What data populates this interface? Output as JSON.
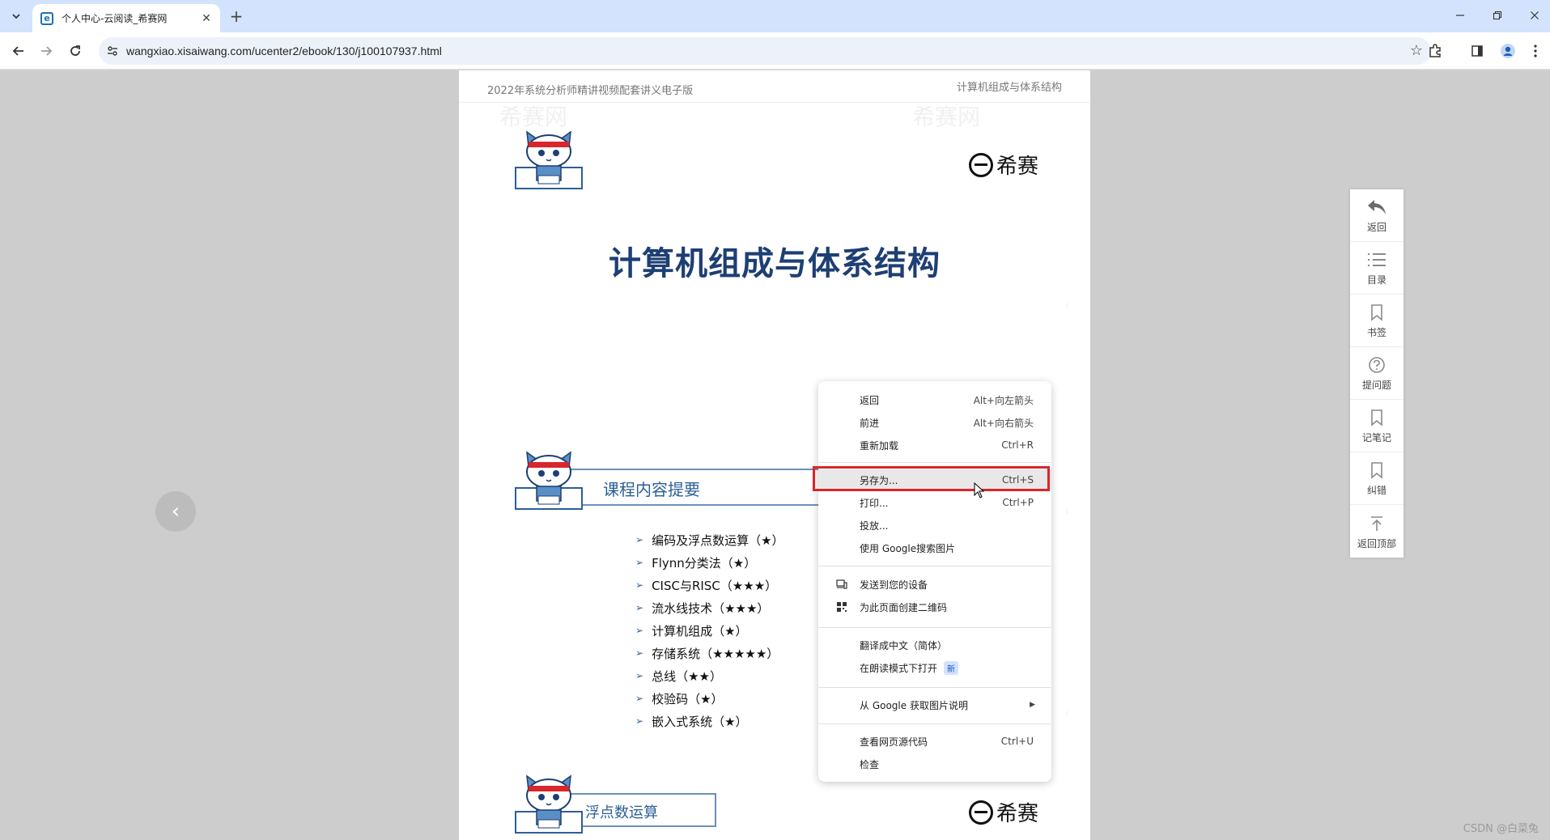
{
  "browser": {
    "tab_title": "个人中心-云阅读_希赛网",
    "favicon_letter": "e",
    "url": "wangxiao.xisaiwang.com/ucenter2/ebook/130/j100107937.html"
  },
  "document": {
    "header_left": "2022年系统分析师精讲视频配套讲义电子版",
    "header_right": "计算机组成与体系结构",
    "watermark_text": "希赛网",
    "brand": "希赛",
    "title": "计算机组成与体系结构",
    "section1_title": "课程内容提要",
    "toc": [
      "编码及浮点数运算（★）",
      "Flynn分类法（★）",
      "CISC与RISC（★★★）",
      "流水线技术（★★★）",
      "计算机组成（★）",
      "存储系统（★★★★★）",
      "总线（★★）",
      "校验码（★）",
      "嵌入式系统（★）"
    ],
    "section2_title": "浮点数运算"
  },
  "side_panel": [
    {
      "label": "返回",
      "icon": "back-arrow-icon"
    },
    {
      "label": "目录",
      "icon": "list-icon"
    },
    {
      "label": "书签",
      "icon": "bookmark-icon"
    },
    {
      "label": "提问题",
      "icon": "question-icon"
    },
    {
      "label": "记笔记",
      "icon": "note-icon"
    },
    {
      "label": "纠错",
      "icon": "flag-icon"
    },
    {
      "label": "返回顶部",
      "icon": "to-top-icon"
    }
  ],
  "context_menu": {
    "back": {
      "label": "返回",
      "shortcut": "Alt+向左箭头"
    },
    "forward": {
      "label": "前进",
      "shortcut": "Alt+向右箭头"
    },
    "reload": {
      "label": "重新加载",
      "shortcut": "Ctrl+R"
    },
    "save_as": {
      "label": "另存为...",
      "shortcut": "Ctrl+S"
    },
    "print": {
      "label": "打印...",
      "shortcut": "Ctrl+P"
    },
    "cast": {
      "label": "投放..."
    },
    "google_image_search": {
      "label": "使用 Google搜索图片"
    },
    "send_to_devices": {
      "label": "发送到您的设备"
    },
    "qr_code": {
      "label": "为此页面创建二维码"
    },
    "translate": {
      "label": "翻译成中文（简体）"
    },
    "reading_mode": {
      "label": "在朗读模式下打开",
      "badge": "新"
    },
    "google_image_desc": {
      "label": "从 Google 获取图片说明"
    },
    "view_source": {
      "label": "查看网页源代码",
      "shortcut": "Ctrl+U"
    },
    "inspect": {
      "label": "检查"
    }
  },
  "corner_watermark": "CSDN @白菜兔",
  "colors": {
    "chrome_tabstrip": "#d3e3fd",
    "title_blue": "#1d3f73",
    "highlight_red": "#d9262b"
  }
}
